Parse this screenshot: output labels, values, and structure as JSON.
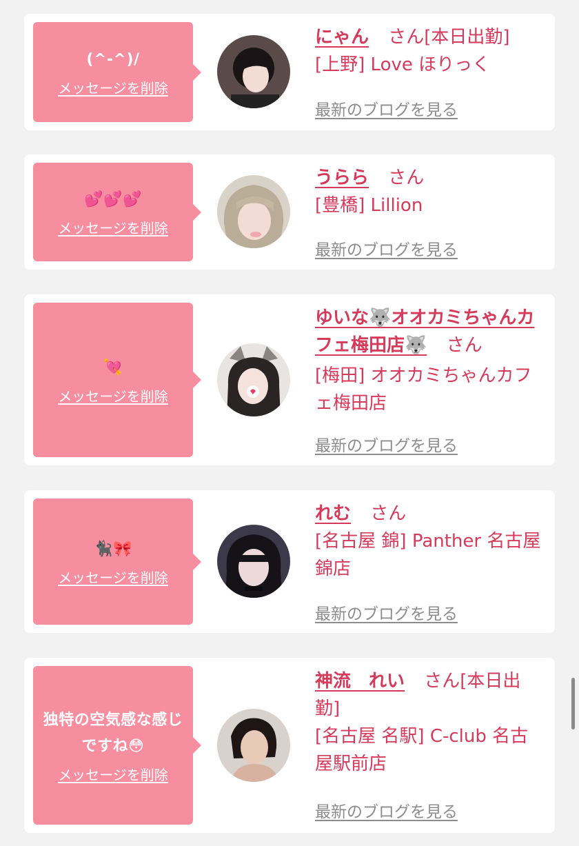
{
  "delete_label": "メッセージを削除",
  "blog_label": "最新のブログを見る",
  "colors": {
    "accent": "#d63a5b",
    "bubble": "#f78ea0",
    "muted": "#8c8c8c"
  },
  "items": [
    {
      "message": "(^-^)/",
      "name": "にゃん",
      "suffix": "さん[本日出勤]",
      "shop": "[上野] Love ほりっく"
    },
    {
      "message": "💕💕💕",
      "name": "うらら",
      "suffix": "さん",
      "shop": "[豊橋] Lillion"
    },
    {
      "message": "💘",
      "name": "ゆいな🐺オオカミちゃんカフェ梅田店🐺",
      "suffix": "さん",
      "shop": "[梅田] オオカミちゃんカフェ梅田店"
    },
    {
      "message": "🐈‍⬛🎀",
      "name": "れむ",
      "suffix": "さん",
      "shop": "[名古屋 錦] Panther 名古屋錦店"
    },
    {
      "message": "独特の空気感な感じですね😳",
      "name": "神流　れい",
      "suffix": "さん[本日出勤]",
      "shop": "[名古屋 名駅] C-club 名古屋駅前店"
    }
  ]
}
